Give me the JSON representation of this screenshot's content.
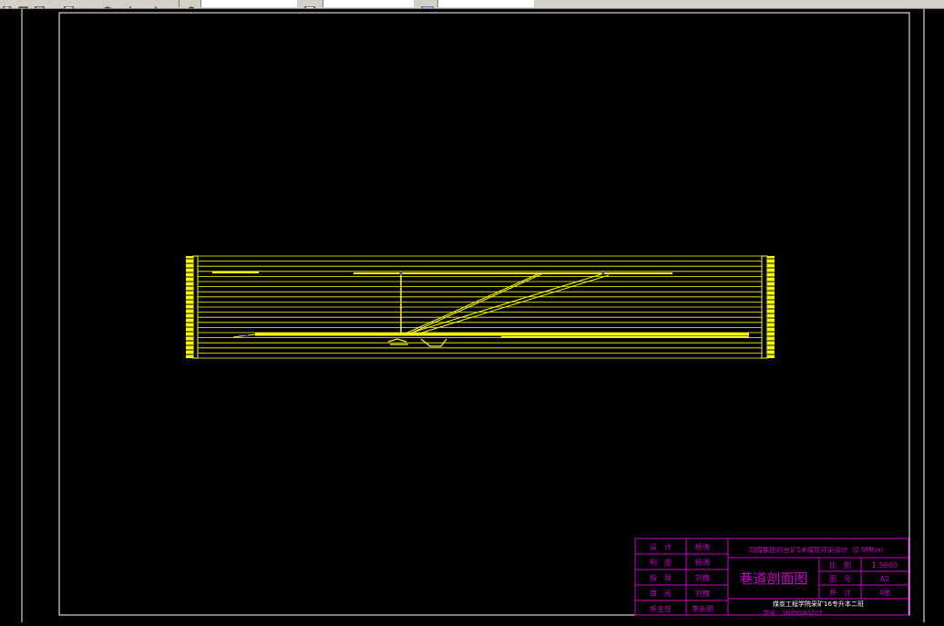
{
  "toolbar": {
    "field1_value": "",
    "field2_value": "",
    "items": [
      "new-icon",
      "open-icon",
      "save-icon",
      "print-icon",
      "cut-icon",
      "match-icon",
      "pan-icon",
      "layer-icon",
      "properties-icon"
    ]
  },
  "title_block": {
    "rows": [
      {
        "role": "设　计",
        "name": "杨涛"
      },
      {
        "role": "制　图",
        "name": "杨涛"
      },
      {
        "role": "指　导",
        "name": "刘拽"
      },
      {
        "role": "审　阅",
        "name": "刘拽"
      },
      {
        "role": "系主任",
        "name": "李永明"
      }
    ],
    "project_title": "同煤集团四台矿5#煤层开采设计（0.9Mt/a）",
    "drawing_title": "巷道剖面图",
    "scale_label": "比　例",
    "scale_value": "1:5000",
    "drawing_no_label": "图　号",
    "drawing_no_value": "A2",
    "total_label": "共　计",
    "total_value": "4张",
    "school": "煤炭工程学院采矿16专升本二班",
    "student_no": "学号：1609040207"
  },
  "colors": {
    "frame": "#ffffff",
    "drawing": "#ffff00",
    "title_block": "#cc00cc",
    "accent_blue": "#3a3aff"
  }
}
